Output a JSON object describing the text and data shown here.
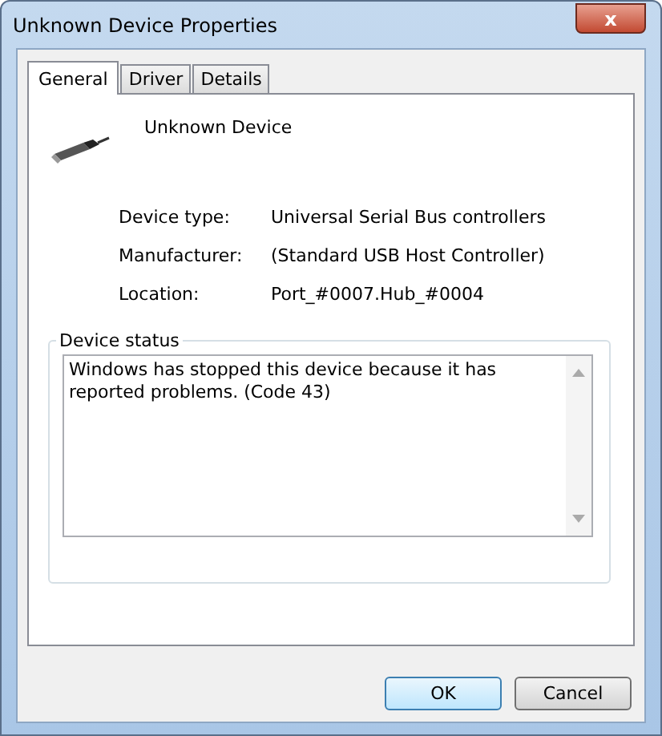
{
  "window": {
    "title": "Unknown Device Properties",
    "close_label": "x"
  },
  "tabs": [
    {
      "label": "General",
      "selected": true
    },
    {
      "label": "Driver",
      "selected": false
    },
    {
      "label": "Details",
      "selected": false
    }
  ],
  "device": {
    "name": "Unknown Device"
  },
  "properties": [
    {
      "label": "Device type:",
      "value": "Universal Serial Bus controllers"
    },
    {
      "label": "Manufacturer:",
      "value": "(Standard USB Host Controller)"
    },
    {
      "label": "Location:",
      "value": "Port_#0007.Hub_#0004"
    }
  ],
  "device_status": {
    "title": "Device status",
    "text": "Windows has stopped this device because it has reported problems. (Code 43)"
  },
  "buttons": [
    {
      "label": "OK",
      "default": true
    },
    {
      "label": "Cancel",
      "default": false
    }
  ]
}
